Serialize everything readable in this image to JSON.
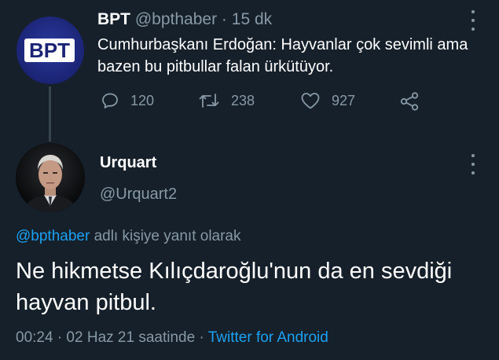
{
  "parent_tweet": {
    "avatar_logo_text": "BPT",
    "display_name": "BPT",
    "handle": "@bpthaber",
    "separator": "·",
    "time": "15 dk",
    "text": "Cumhurbaşkanı Erdoğan: Hayvanlar çok sevimli ama bazen bu pitbullar falan ürkütüyor.",
    "actions": {
      "reply_count": "120",
      "retweet_count": "238",
      "like_count": "927"
    }
  },
  "main_tweet": {
    "display_name": "Urquart",
    "handle": "@Urquart2",
    "reply_mention": "@bpthaber",
    "reply_suffix": "adlı kişiye yanıt olarak",
    "text": "Ne hikmetse Kılıçdaroğlu'nun da en sevdiği hayvan pitbul.",
    "timestamp": "00:24 · 02 Haz 21 saatinde",
    "source_separator": "·",
    "source": "Twitter for Android"
  },
  "icons": {
    "reply": "reply-icon",
    "retweet": "retweet-icon",
    "like": "heart-icon",
    "share": "share-icon",
    "more": "more-vertical-icon"
  },
  "colors": {
    "background": "#15202b",
    "text_primary": "#ffffff",
    "text_secondary": "#8899a6",
    "link": "#1da1f2",
    "thread_line": "#38444d"
  }
}
